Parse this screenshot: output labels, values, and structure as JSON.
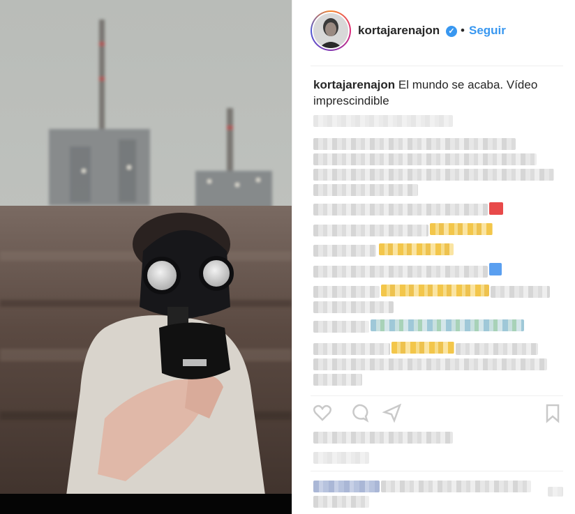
{
  "post": {
    "username": "kortajarenajon",
    "verified_mark": "✓",
    "separator": "•",
    "follow_label": "Seguir",
    "caption_user": "kortajarenajon",
    "caption_text": "El mundo se acaba. Vídeo imprescindible"
  },
  "icons": {
    "like": "heart-icon",
    "comment": "comment-icon",
    "share": "share-icon",
    "save": "bookmark-icon",
    "more_options": "more-options-icon"
  },
  "colors": {
    "accent": "#3897f0",
    "text": "#262626",
    "divider": "#efefef"
  }
}
